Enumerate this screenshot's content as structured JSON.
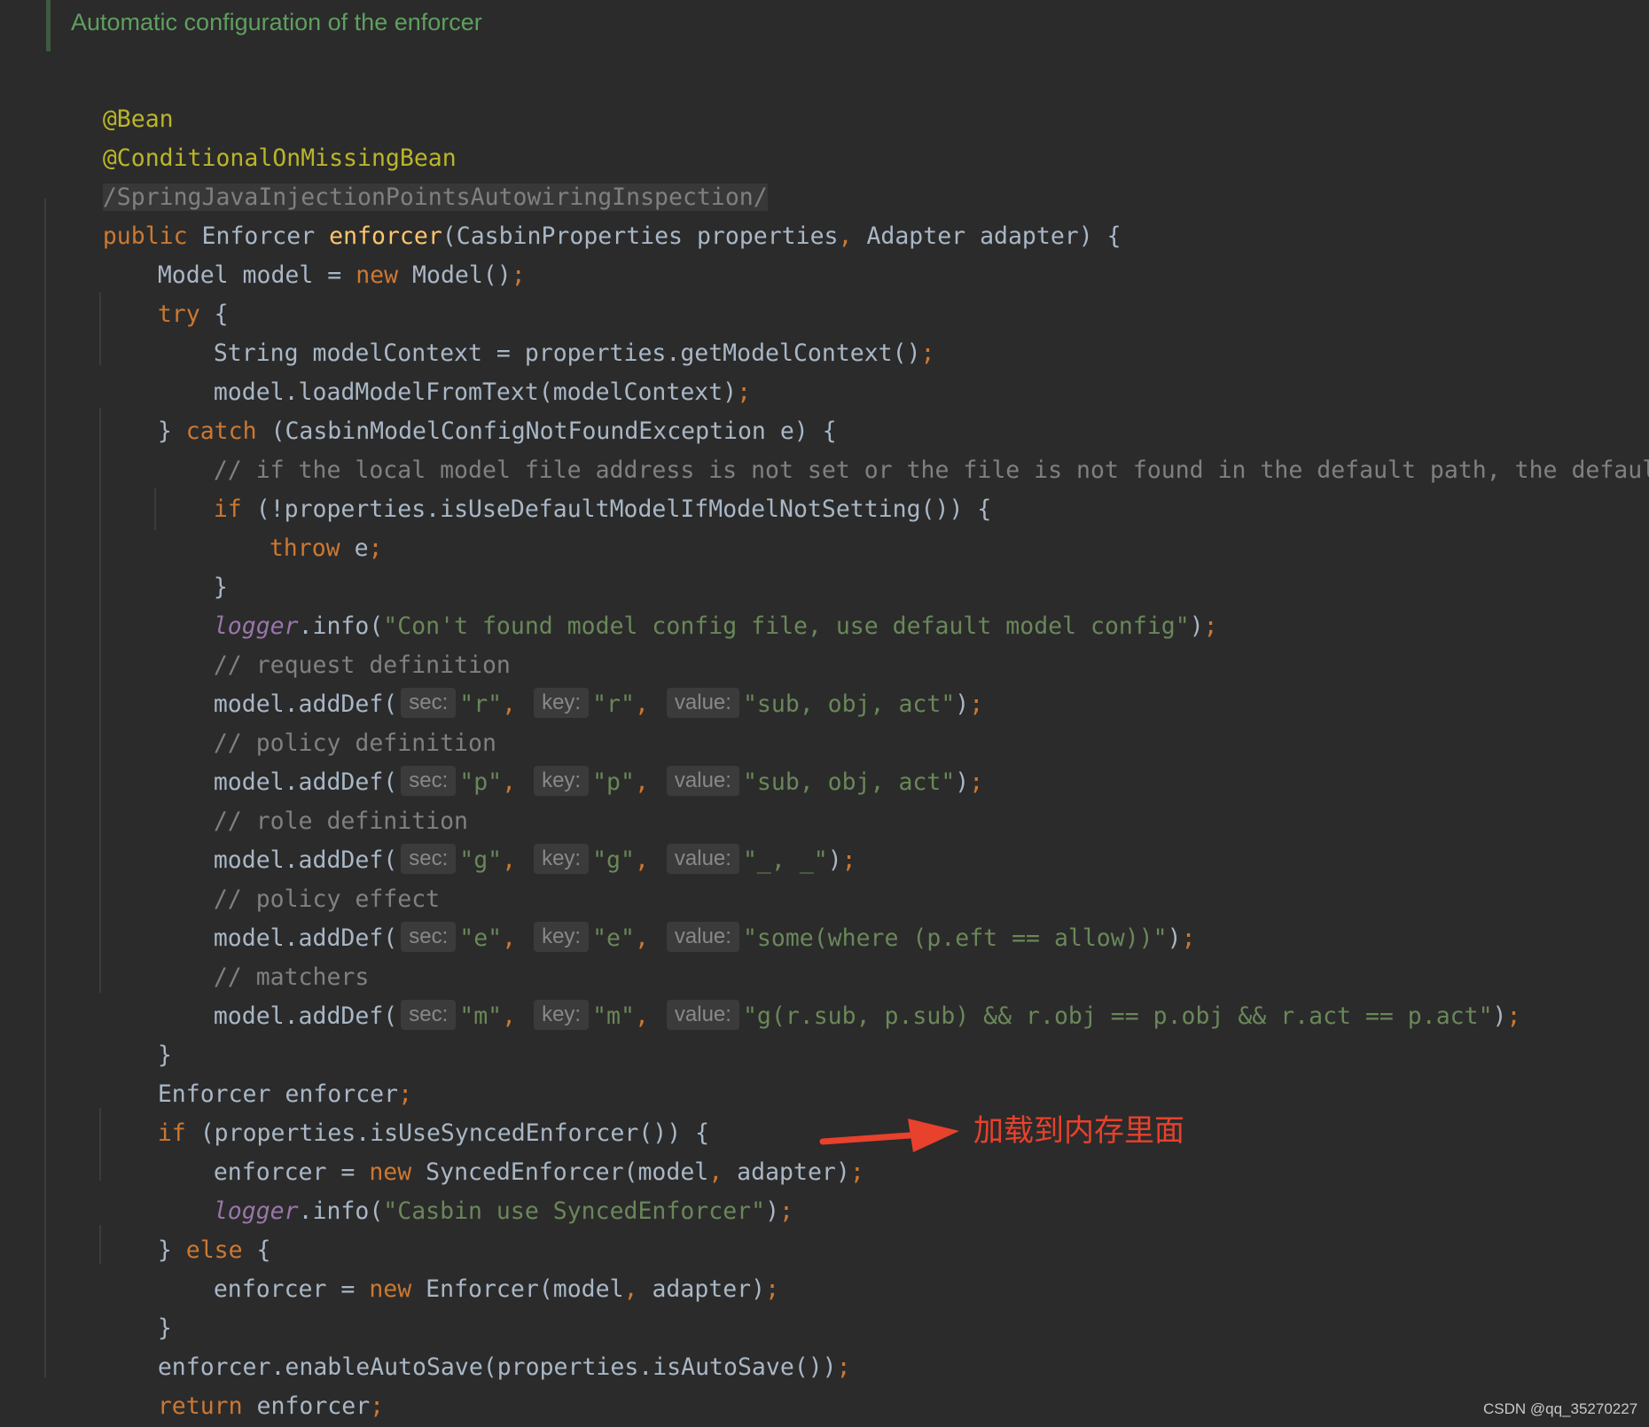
{
  "doc_comment": "Automatic configuration of the enforcer",
  "colors": {
    "background": "#2b2b2b",
    "keyword": "#cc7832",
    "annotation": "#bbb529",
    "method_declaration": "#ffc66d",
    "string": "#6a8759",
    "comment": "#808080",
    "static_field": "#9876aa",
    "default_text": "#a9b7c6",
    "doc_comment": "#5f9f5f",
    "red_arrow": "#e8412c"
  },
  "code": {
    "l1": "@Bean",
    "l2": "@ConditionalOnMissingBean",
    "l3": "/SpringJavaInjectionPointsAutowiringInspection/",
    "l4": {
      "kw": "public",
      "type": "Enforcer",
      "fn": "enforcer",
      "params_a": "(CasbinProperties properties",
      "comma": ",",
      "params_b": " Adapter adapter) {"
    },
    "l5": {
      "a": "Model model = ",
      "kw": "new",
      "b": " Model()",
      "semi": ";"
    },
    "l6": {
      "kw": "try",
      "b": " {"
    },
    "l7": {
      "a": "String modelContext = properties.getModelContext()",
      "semi": ";"
    },
    "l8": {
      "a": "model.loadModelFromText(modelContext)",
      "semi": ";"
    },
    "l9": {
      "a": "} ",
      "kw": "catch",
      "b": " (CasbinModelConfigNotFoundException e) {"
    },
    "l10": "// if the local model file address is not set or the file is not found in the default path, the default rbac",
    "l11": {
      "kw": "if",
      "b": " (!properties.isUseDefaultModelIfModelNotSetting()) {"
    },
    "l12": {
      "kw": "throw",
      "b": " e",
      "semi": ";"
    },
    "l13": "}",
    "l14": {
      "field": "logger",
      "a": ".info(",
      "str": "\"Con't found model config file, use default model config\"",
      "b": ")",
      "semi": ";"
    },
    "l15": "// request definition",
    "l16": {
      "sec": "\"r\"",
      "key": "\"r\"",
      "value": "\"sub, obj, act\""
    },
    "l17": "// policy definition",
    "l18": {
      "sec": "\"p\"",
      "key": "\"p\"",
      "value": "\"sub, obj, act\""
    },
    "l19": "// role definition",
    "l20": {
      "sec": "\"g\"",
      "key": "\"g\"",
      "value": "\"_, _\""
    },
    "l21": "// policy effect",
    "l22": {
      "sec": "\"e\"",
      "key": "\"e\"",
      "value": "\"some(where (p.eft == allow))\""
    },
    "l23": "// matchers",
    "l24": {
      "sec": "\"m\"",
      "key": "\"m\"",
      "value": "\"g(r.sub, p.sub) && r.obj == p.obj && r.act == p.act\""
    },
    "l25": "}",
    "l26": {
      "a": "Enforcer enforcer",
      "semi": ";"
    },
    "l27": {
      "kw": "if",
      "b": " (properties.isUseSyncedEnforcer()) {"
    },
    "l28": {
      "a": "enforcer = ",
      "kw": "new",
      "b": " SyncedEnforcer(model",
      "comma": ",",
      "c": " adapter)",
      "semi": ";"
    },
    "l29": {
      "field": "logger",
      "a": ".info(",
      "str": "\"Casbin use SyncedEnforcer\"",
      "b": ")",
      "semi": ";"
    },
    "l30": {
      "a": "} ",
      "kw": "else",
      "b": " {"
    },
    "l31": {
      "a": "enforcer = ",
      "kw": "new",
      "b": " Enforcer(model",
      "comma": ",",
      "c": " adapter)",
      "semi": ";"
    },
    "l32": "}",
    "l33": {
      "a": "enforcer.enableAutoSave(properties.isAutoSave())",
      "semi": ";"
    },
    "l34": {
      "kw": "return",
      "b": " enforcer",
      "semi": ";"
    },
    "l35": "}"
  },
  "adddef": {
    "call": "model.addDef(",
    "close": ")",
    "semi": ";",
    "comma": ",",
    "hint_sec": "sec:",
    "hint_key": "key:",
    "hint_value": "value:"
  },
  "annotation_text": "加载到内存里面",
  "watermark": "CSDN @qq_35270227"
}
